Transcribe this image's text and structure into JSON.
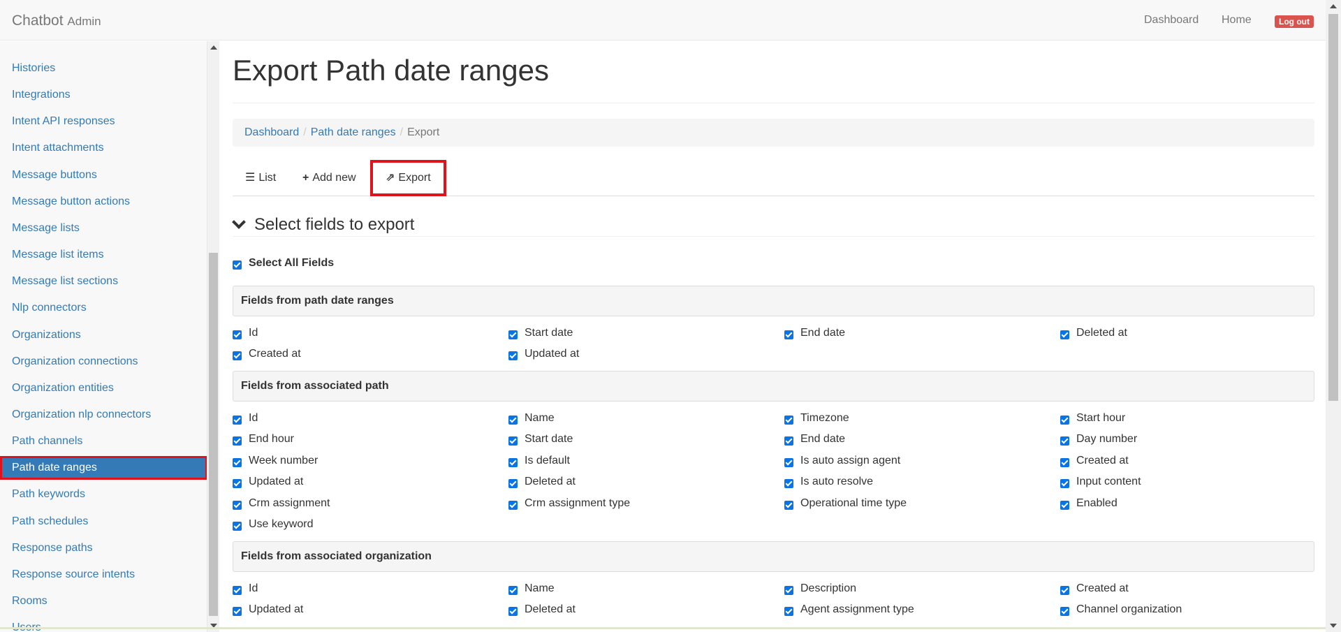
{
  "navbar": {
    "brand": "Chatbot",
    "brand_sub": "Admin",
    "links": [
      "Dashboard",
      "Home"
    ],
    "logout": "Log out",
    "logout_color": "#d9534f"
  },
  "sidebar": {
    "items": [
      "Histories",
      "Integrations",
      "Intent API responses",
      "Intent attachments",
      "Message buttons",
      "Message button actions",
      "Message lists",
      "Message list items",
      "Message list sections",
      "Nlp connectors",
      "Organizations",
      "Organization connections",
      "Organization entities",
      "Organization nlp connectors",
      "Path channels",
      "Path date ranges",
      "Path keywords",
      "Path schedules",
      "Response paths",
      "Response source intents",
      "Rooms",
      "Users"
    ],
    "active": "Path date ranges",
    "active_color": "#337ab7",
    "highlight_color": "#e0131c"
  },
  "main": {
    "title": "Export Path date ranges",
    "breadcrumb": [
      "Dashboard",
      "Path date ranges",
      "Export"
    ],
    "tabs": [
      {
        "icon": "list-icon",
        "label": "List"
      },
      {
        "icon": "plus-icon",
        "label": "Add new"
      },
      {
        "icon": "share-icon",
        "label": "Export"
      }
    ],
    "section_title": "Select fields to export",
    "select_all": "Select All Fields",
    "groups": [
      {
        "title": "Fields from path date ranges",
        "fields": [
          "Id",
          "Start date",
          "End date",
          "Deleted at",
          "Created at",
          "Updated at"
        ]
      },
      {
        "title": "Fields from associated path",
        "fields": [
          "Id",
          "Name",
          "Timezone",
          "Start hour",
          "End hour",
          "Start date",
          "End date",
          "Day number",
          "Week number",
          "Is default",
          "Is auto assign agent",
          "Created at",
          "Updated at",
          "Deleted at",
          "Is auto resolve",
          "Input content",
          "Crm assignment",
          "Crm assignment type",
          "Operational time type",
          "Enabled",
          "Use keyword"
        ]
      },
      {
        "title": "Fields from associated organization",
        "fields": [
          "Id",
          "Name",
          "Description",
          "Created at",
          "Updated at",
          "Deleted at",
          "Agent assignment type",
          "Channel organization"
        ]
      }
    ]
  },
  "checkbox_color": "#0b74e5"
}
